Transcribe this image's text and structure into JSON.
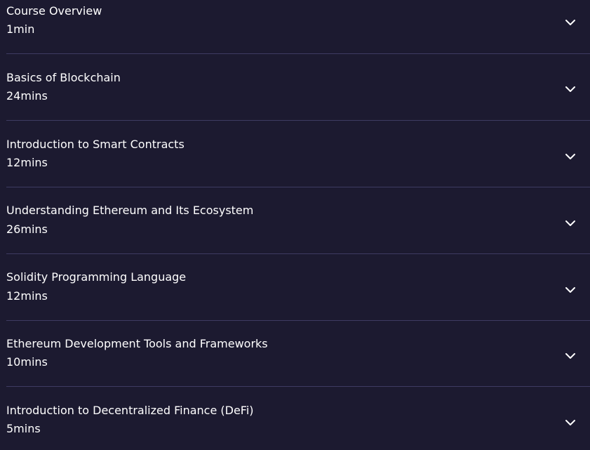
{
  "colors": {
    "background": "#1c1a30",
    "text": "#ffffff",
    "divider": "#3e3b62"
  },
  "sections": [
    {
      "title": "Course Overview",
      "duration": "1min",
      "icon": "chevron-down-icon"
    },
    {
      "title": "Basics of Blockchain",
      "duration": "24mins",
      "icon": "chevron-down-icon"
    },
    {
      "title": "Introduction to Smart Contracts",
      "duration": "12mins",
      "icon": "chevron-down-icon"
    },
    {
      "title": "Understanding Ethereum and Its Ecosystem",
      "duration": "26mins",
      "icon": "chevron-down-icon"
    },
    {
      "title": "Solidity Programming Language",
      "duration": "12mins",
      "icon": "chevron-down-icon"
    },
    {
      "title": "Ethereum Development Tools and Frameworks",
      "duration": "10mins",
      "icon": "chevron-down-icon"
    },
    {
      "title": "Introduction to Decentralized Finance (DeFi)",
      "duration": "5mins",
      "icon": "chevron-down-icon"
    }
  ]
}
